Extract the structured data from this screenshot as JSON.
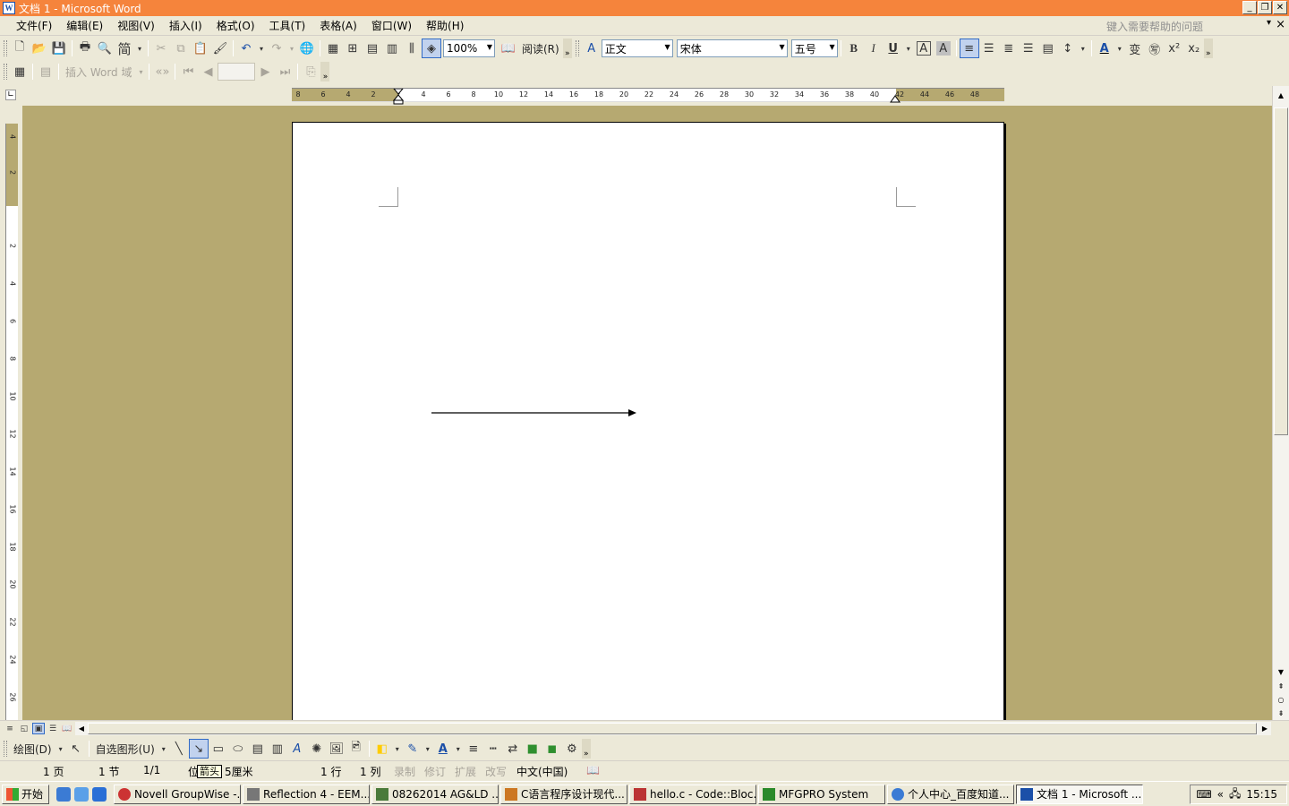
{
  "window": {
    "title": "文档 1 - Microsoft Word"
  },
  "menu": {
    "items": [
      "文件(F)",
      "编辑(E)",
      "视图(V)",
      "插入(I)",
      "格式(O)",
      "工具(T)",
      "表格(A)",
      "窗口(W)",
      "帮助(H)"
    ],
    "help_placeholder": "键入需要帮助的问题"
  },
  "toolbar": {
    "zoom": "100%",
    "read_label": "阅读(R)",
    "style": "正文",
    "font": "宋体",
    "size": "五号",
    "bold": "B",
    "italic": "I",
    "underline": "U",
    "convert_label": "简"
  },
  "toolbar2": {
    "insert_field_label": "插入 Word 域"
  },
  "ruler": {
    "h_labels": [
      "8",
      "6",
      "4",
      "2",
      "2",
      "4",
      "6",
      "8",
      "10",
      "12",
      "14",
      "16",
      "18",
      "20",
      "22",
      "24",
      "26",
      "28",
      "30",
      "32",
      "34",
      "36",
      "38",
      "40",
      "42",
      "44",
      "46",
      "48"
    ],
    "v_labels": [
      "4",
      "2",
      "2",
      "4",
      "6",
      "8",
      "10",
      "12",
      "14",
      "16",
      "18",
      "20",
      "22",
      "24",
      "26"
    ]
  },
  "drawing": {
    "draw_label": "绘图(D)",
    "autoshapes_label": "自选图形(U)"
  },
  "status": {
    "page": "1 页",
    "section": "1 节",
    "page_of": "1/1",
    "position_prefix": "位",
    "position_value": "5厘米",
    "line": "1 行",
    "column": "1 列",
    "rec": "录制",
    "trk": "修订",
    "ext": "扩展",
    "ovr": "改写",
    "language": "中文(中国)"
  },
  "tooltip": "箭头",
  "taskbar": {
    "start": "开始",
    "tasks": [
      "Novell GroupWise -...",
      "Reflection 4 - EEM...",
      "08262014 AG&LD ...",
      "C语言程序设计现代...",
      "hello.c - Code::Bloc...",
      "MFGPRO System",
      "个人中心_百度知道...",
      "文档 1 - Microsoft ..."
    ],
    "clock": "15:15"
  },
  "colors": {
    "titlebar": "#f5843c",
    "workspace": "#b6a971",
    "chrome": "#ece9d8"
  }
}
